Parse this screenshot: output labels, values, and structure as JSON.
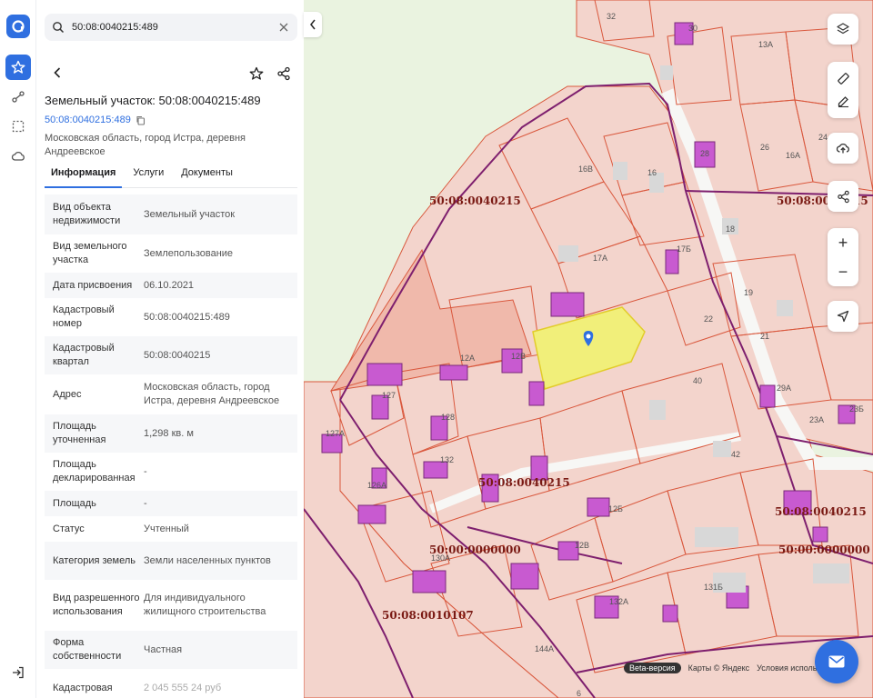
{
  "search": {
    "value": "50:08:0040215:489"
  },
  "card": {
    "title": "Земельный участок: 50:08:0040215:489",
    "cad_number": "50:08:0040215:489",
    "address": "Московская область, город Истра, деревня Андреевское"
  },
  "tabs": [
    {
      "label": "Информация"
    },
    {
      "label": "Услуги"
    },
    {
      "label": "Документы"
    }
  ],
  "rows": [
    {
      "k": "Вид объекта недвижимости",
      "v": "Земельный участок"
    },
    {
      "k": "Вид земельного участка",
      "v": "Землепользование"
    },
    {
      "k": "Дата присвоения",
      "v": "06.10.2021"
    },
    {
      "k": "Кадастровый номер",
      "v": "50:08:0040215:489"
    },
    {
      "k": "Кадастровый квартал",
      "v": "50:08:0040215"
    },
    {
      "k": "Адрес",
      "v": "Московская область, город Истра, деревня Андреевское"
    },
    {
      "k": "Площадь уточненная",
      "v": "1,298 кв. м"
    },
    {
      "k": "Площадь декларированная",
      "v": "-"
    },
    {
      "k": "Площадь",
      "v": "-"
    },
    {
      "k": "Статус",
      "v": "Учтенный"
    },
    {
      "k": "Категория земель",
      "v": "Земли населенных пунктов"
    },
    {
      "k": "Вид разрешенного использования",
      "v": "Для индивидуального жилищного строительства"
    },
    {
      "k": "Форма собственности",
      "v": "Частная"
    },
    {
      "k": "Кадастровая",
      "v": "2 045 555 24 руб"
    }
  ],
  "map": {
    "block_labels": [
      "50:08:0040215",
      "50:08:0040215",
      "50:08:0040215",
      "50:08:0040215",
      "50:00:0000000",
      "50:00:0000000",
      "50:08:0010107"
    ],
    "parcel_numbers": [
      "32",
      "30",
      "13А",
      "26",
      "24",
      "28",
      "16А",
      "16В",
      "16",
      "17Б",
      "18",
      "17А",
      "19",
      "21",
      "22",
      "40",
      "29А",
      "23А",
      "23Б",
      "42",
      "12А",
      "12В",
      "127",
      "127А",
      "128",
      "126А",
      "132",
      "12Б",
      "12В",
      "130А",
      "131Б",
      "132А",
      "144А",
      "6"
    ],
    "attribution": {
      "beta": "Beta-версия",
      "maps": "Карты © Яндекс",
      "terms": "Условия использ"
    },
    "colors": {
      "parcel_fill": "#f3d4cc",
      "parcel_stroke": "#d9573c",
      "selected_fill": "#f1ef7a",
      "building_fill": "#c85ad0",
      "quarter_border": "#7e1f6e",
      "label_color": "#7a1a14"
    }
  }
}
